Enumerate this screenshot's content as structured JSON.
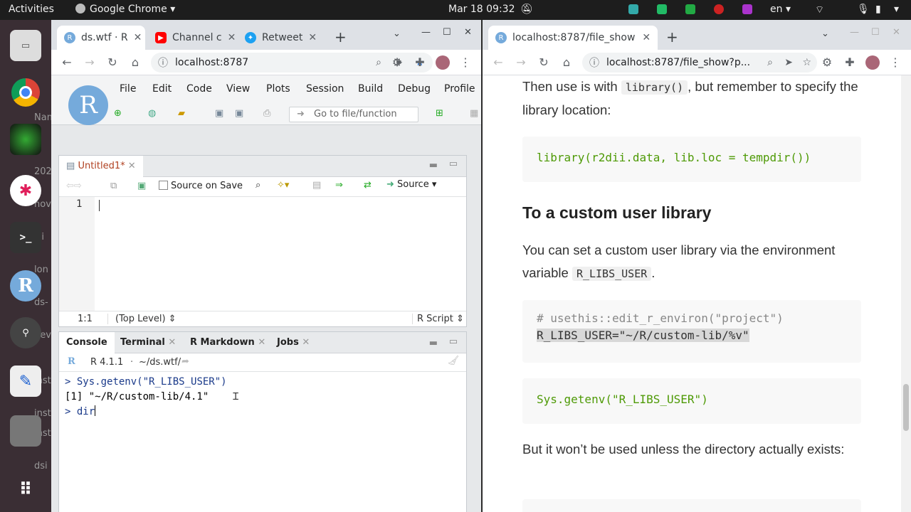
{
  "topbar": {
    "activities": "Activities",
    "app": "Google Chrome",
    "clock": "Mar 18  09:32",
    "lang": "en"
  },
  "dock": {
    "behind_labels": [
      "Name",
      "202",
      "nov",
      "isi",
      "lon",
      "ds-",
      "dev",
      "inst",
      "inst",
      "inst",
      "dsi"
    ]
  },
  "left_browser": {
    "tabs": [
      {
        "title": "ds.wtf · R",
        "icon": "R"
      },
      {
        "title": "Channel c",
        "icon": "youtube-icon"
      },
      {
        "title": "Retweet",
        "icon": "twitter-icon"
      }
    ],
    "url": "localhost:8787"
  },
  "rstudio": {
    "menu": [
      "File",
      "Edit",
      "Code",
      "View",
      "Plots",
      "Session",
      "Build",
      "Debug",
      "Profile"
    ],
    "goto_placeholder": "Go to file/function",
    "editor": {
      "tab": "Untitled1*",
      "source_on_save": "Source on Save",
      "source": "Source",
      "line_no": "1",
      "pos": "1:1",
      "level": "(Top Level)",
      "filetype": "R Script"
    },
    "console": {
      "tabs": [
        "Console",
        "Terminal",
        "R Markdown",
        "Jobs"
      ],
      "version": "R 4.1.1",
      "path": "~/ds.wtf/",
      "lines": [
        {
          "prompt": ">",
          "text": "Sys.getenv(\"R_LIBS_USER\")"
        },
        {
          "prompt": "",
          "text": "[1] \"~/R/custom-lib/4.1\""
        },
        {
          "prompt": ">",
          "text": "dir"
        }
      ]
    }
  },
  "right_browser": {
    "tab": "localhost:8787/file_show",
    "url": "localhost:8787/file_show?p...",
    "doc": {
      "p1a": "Then use is with ",
      "p1code": "library()",
      "p1b": ", but remember to specify the library location:",
      "code1": "library(r2dii.data, lib.loc = tempdir())",
      "h2": "To a custom user library",
      "p2a": "You can set a custom user library via the environment variable ",
      "p2code": "R_LIBS_USER",
      "p2b": ".",
      "code2a": "# usethis::edit_r_environ(\"project\")",
      "code2b": "R_LIBS_USER=\"~/R/custom-lib/%v\"",
      "code3": "Sys.getenv(\"R_LIBS_USER\")",
      "p3": "But it won’t be used unless the directory actually exists:"
    }
  },
  "colors": {
    "accent_blue": "#1a73e8",
    "r_blue": "#75aadb",
    "green_code": "#4e9a06",
    "string_code": "#2e7d32",
    "comment": "#888888"
  }
}
